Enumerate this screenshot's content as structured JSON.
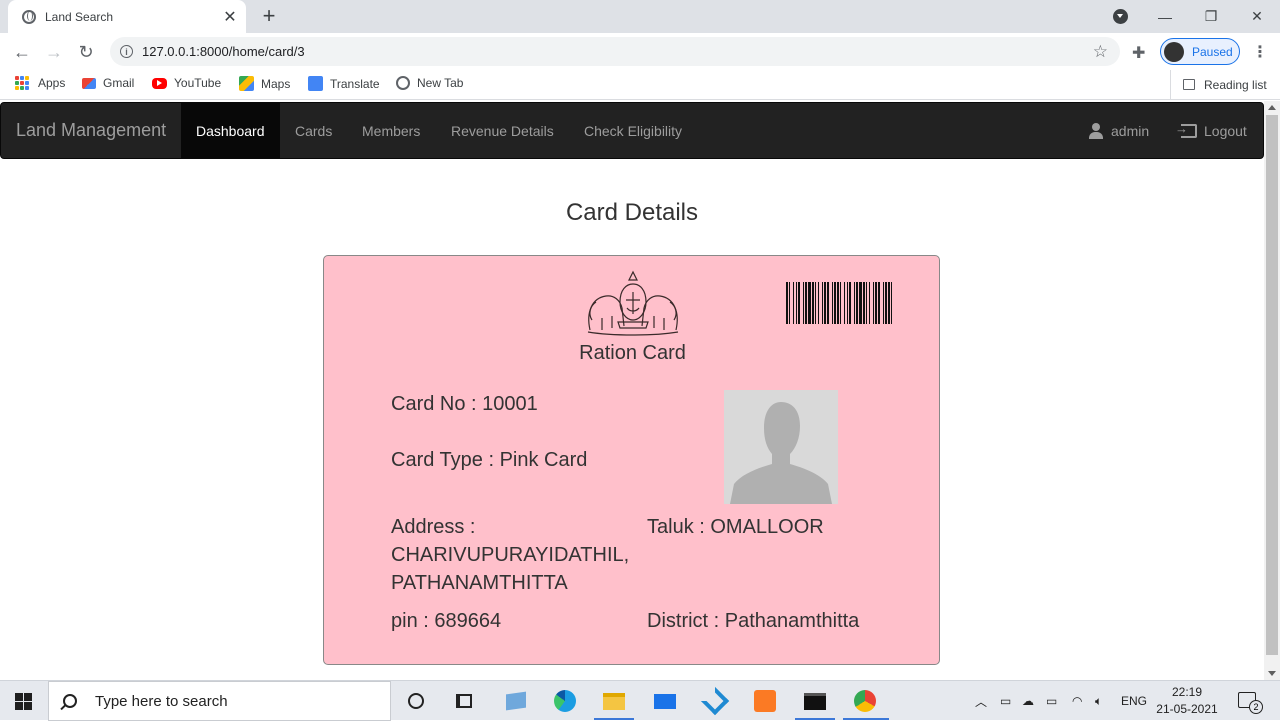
{
  "browser": {
    "tab_title": "Land Search",
    "url": "127.0.0.1:8000/home/card/3",
    "profile_label": "Paused",
    "bookmarks": [
      "Apps",
      "Gmail",
      "YouTube",
      "Maps",
      "Translate",
      "New Tab"
    ],
    "reading_list": "Reading list"
  },
  "nav": {
    "brand": "Land Management",
    "items": [
      "Dashboard",
      "Cards",
      "Members",
      "Revenue Details",
      "Check Eligibility"
    ],
    "active_item": "Dashboard",
    "user": "admin",
    "logout": "Logout"
  },
  "page": {
    "title": "Card Details"
  },
  "card": {
    "title": "Ration Card",
    "card_no": "Card No : 10001",
    "card_type": "Card Type : Pink Card",
    "address_line1": "Address :",
    "address_line2": "CHARIVUPURAYIDATHIL,",
    "address_line3": "PATHANAMTHITTA",
    "pin": "pin : 689664",
    "taluk": "Taluk : OMALLOOR",
    "district": "District : Pathanamthitta",
    "background_color": "#ffc0cb"
  },
  "taskbar": {
    "search_placeholder": "Type here to search",
    "language": "ENG",
    "time": "22:19",
    "date": "21-05-2021",
    "notification_count": "2"
  }
}
